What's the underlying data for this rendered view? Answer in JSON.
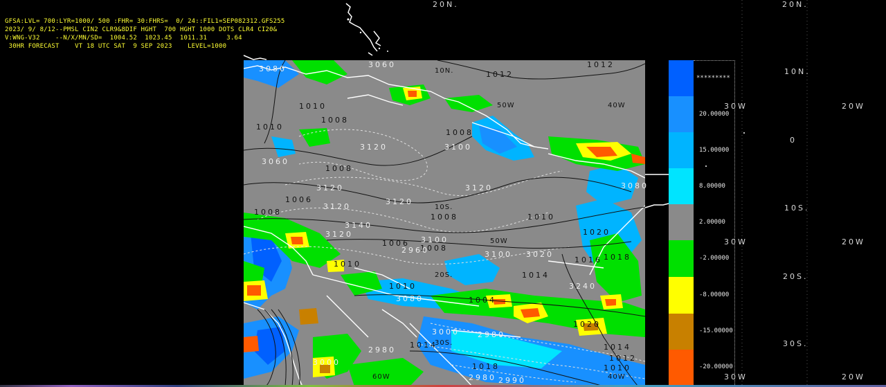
{
  "header": {
    "line1": "GFSA:LVL= 700:LYR=1000/ 500 :FHR= 30:FHRS=  0/ 24::FIL1=SEP082312.GFS255",
    "line2": "2023/ 9/ 8/12--PMSL CIN2 CLR9&8DIF HGHT  700 HGHT 1000 DOTS CLR4 CI20&",
    "line3": "V:WNG-V32    --N/X/MN/SD=  1004.52  1023.45  1011.31     3.64",
    "line4": " 30HR FORECAST    VT 18 UTC SAT  9 SEP 2023    LEVEL=1000"
  },
  "lat_lon_labels": {
    "top_20n_a": "20N.",
    "top_20n_b": "20N.",
    "right_10n": "10N.",
    "right_0": "0",
    "right_10s": "10S.",
    "right_20s": "20S.",
    "right_30s": "30S.",
    "w30_a": "30W",
    "w20_a": "20W",
    "w30_b": "30W",
    "w20_b": "20W",
    "w30_c": "30W",
    "w20_c": "20W",
    "map_10n": "10N.",
    "map_40w": "40W",
    "map_50w_a": "50W",
    "map_50w_b": "50W",
    "map_40w_b": "40W",
    "map_10s": "10S.",
    "map_20s": "20S.",
    "map_30s": "30S.",
    "map_60w": "60W"
  },
  "contour_labels": [
    "1012",
    "1012",
    "3060",
    "3080",
    "3100",
    "3120",
    "3120",
    "3120",
    "3120",
    "3120",
    "3120",
    "1008",
    "1008",
    "1010",
    "1010",
    "1010",
    "1006",
    "1008",
    "1008",
    "1008",
    "1010",
    "1010",
    "1014",
    "1016",
    "1018",
    "1020",
    "1020",
    "3080",
    "3080",
    "3100",
    "2980",
    "2980",
    "2980",
    "3000",
    "1018",
    "1014",
    "1014",
    "1012",
    "1010",
    "3240",
    "3060",
    "1004",
    "1008",
    "3100",
    "1006",
    "3020",
    "3000",
    "2960",
    "3140",
    "2990"
  ],
  "colorbar": {
    "stars": "*********",
    "values": [
      "20.00000",
      "15.00000",
      "8.00000",
      "2.00000",
      "-2.00000",
      "-8.00000",
      "-15.00000",
      "-20.00000"
    ],
    "colors": [
      "#0060ff",
      "#1890ff",
      "#00b4ff",
      "#00e4ff",
      "#8a8a8a",
      "#00e000",
      "#ffff00",
      "#c88000",
      "#ff5a00"
    ]
  },
  "colors": {
    "header_text": "#ffff33",
    "map_background": "#8a8a8a",
    "background": "#000000"
  }
}
